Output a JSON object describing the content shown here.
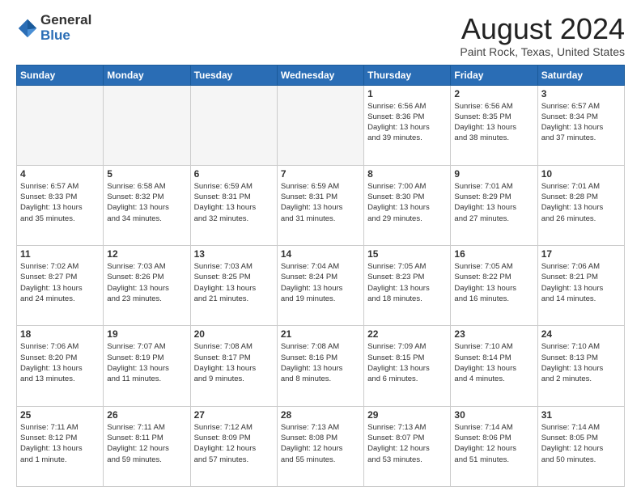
{
  "logo": {
    "general": "General",
    "blue": "Blue"
  },
  "header": {
    "month": "August 2024",
    "location": "Paint Rock, Texas, United States"
  },
  "weekdays": [
    "Sunday",
    "Monday",
    "Tuesday",
    "Wednesday",
    "Thursday",
    "Friday",
    "Saturday"
  ],
  "weeks": [
    [
      {
        "day": "",
        "info": ""
      },
      {
        "day": "",
        "info": ""
      },
      {
        "day": "",
        "info": ""
      },
      {
        "day": "",
        "info": ""
      },
      {
        "day": "1",
        "info": "Sunrise: 6:56 AM\nSunset: 8:36 PM\nDaylight: 13 hours\nand 39 minutes."
      },
      {
        "day": "2",
        "info": "Sunrise: 6:56 AM\nSunset: 8:35 PM\nDaylight: 13 hours\nand 38 minutes."
      },
      {
        "day": "3",
        "info": "Sunrise: 6:57 AM\nSunset: 8:34 PM\nDaylight: 13 hours\nand 37 minutes."
      }
    ],
    [
      {
        "day": "4",
        "info": "Sunrise: 6:57 AM\nSunset: 8:33 PM\nDaylight: 13 hours\nand 35 minutes."
      },
      {
        "day": "5",
        "info": "Sunrise: 6:58 AM\nSunset: 8:32 PM\nDaylight: 13 hours\nand 34 minutes."
      },
      {
        "day": "6",
        "info": "Sunrise: 6:59 AM\nSunset: 8:31 PM\nDaylight: 13 hours\nand 32 minutes."
      },
      {
        "day": "7",
        "info": "Sunrise: 6:59 AM\nSunset: 8:31 PM\nDaylight: 13 hours\nand 31 minutes."
      },
      {
        "day": "8",
        "info": "Sunrise: 7:00 AM\nSunset: 8:30 PM\nDaylight: 13 hours\nand 29 minutes."
      },
      {
        "day": "9",
        "info": "Sunrise: 7:01 AM\nSunset: 8:29 PM\nDaylight: 13 hours\nand 27 minutes."
      },
      {
        "day": "10",
        "info": "Sunrise: 7:01 AM\nSunset: 8:28 PM\nDaylight: 13 hours\nand 26 minutes."
      }
    ],
    [
      {
        "day": "11",
        "info": "Sunrise: 7:02 AM\nSunset: 8:27 PM\nDaylight: 13 hours\nand 24 minutes."
      },
      {
        "day": "12",
        "info": "Sunrise: 7:03 AM\nSunset: 8:26 PM\nDaylight: 13 hours\nand 23 minutes."
      },
      {
        "day": "13",
        "info": "Sunrise: 7:03 AM\nSunset: 8:25 PM\nDaylight: 13 hours\nand 21 minutes."
      },
      {
        "day": "14",
        "info": "Sunrise: 7:04 AM\nSunset: 8:24 PM\nDaylight: 13 hours\nand 19 minutes."
      },
      {
        "day": "15",
        "info": "Sunrise: 7:05 AM\nSunset: 8:23 PM\nDaylight: 13 hours\nand 18 minutes."
      },
      {
        "day": "16",
        "info": "Sunrise: 7:05 AM\nSunset: 8:22 PM\nDaylight: 13 hours\nand 16 minutes."
      },
      {
        "day": "17",
        "info": "Sunrise: 7:06 AM\nSunset: 8:21 PM\nDaylight: 13 hours\nand 14 minutes."
      }
    ],
    [
      {
        "day": "18",
        "info": "Sunrise: 7:06 AM\nSunset: 8:20 PM\nDaylight: 13 hours\nand 13 minutes."
      },
      {
        "day": "19",
        "info": "Sunrise: 7:07 AM\nSunset: 8:19 PM\nDaylight: 13 hours\nand 11 minutes."
      },
      {
        "day": "20",
        "info": "Sunrise: 7:08 AM\nSunset: 8:17 PM\nDaylight: 13 hours\nand 9 minutes."
      },
      {
        "day": "21",
        "info": "Sunrise: 7:08 AM\nSunset: 8:16 PM\nDaylight: 13 hours\nand 8 minutes."
      },
      {
        "day": "22",
        "info": "Sunrise: 7:09 AM\nSunset: 8:15 PM\nDaylight: 13 hours\nand 6 minutes."
      },
      {
        "day": "23",
        "info": "Sunrise: 7:10 AM\nSunset: 8:14 PM\nDaylight: 13 hours\nand 4 minutes."
      },
      {
        "day": "24",
        "info": "Sunrise: 7:10 AM\nSunset: 8:13 PM\nDaylight: 13 hours\nand 2 minutes."
      }
    ],
    [
      {
        "day": "25",
        "info": "Sunrise: 7:11 AM\nSunset: 8:12 PM\nDaylight: 13 hours\nand 1 minute."
      },
      {
        "day": "26",
        "info": "Sunrise: 7:11 AM\nSunset: 8:11 PM\nDaylight: 12 hours\nand 59 minutes."
      },
      {
        "day": "27",
        "info": "Sunrise: 7:12 AM\nSunset: 8:09 PM\nDaylight: 12 hours\nand 57 minutes."
      },
      {
        "day": "28",
        "info": "Sunrise: 7:13 AM\nSunset: 8:08 PM\nDaylight: 12 hours\nand 55 minutes."
      },
      {
        "day": "29",
        "info": "Sunrise: 7:13 AM\nSunset: 8:07 PM\nDaylight: 12 hours\nand 53 minutes."
      },
      {
        "day": "30",
        "info": "Sunrise: 7:14 AM\nSunset: 8:06 PM\nDaylight: 12 hours\nand 51 minutes."
      },
      {
        "day": "31",
        "info": "Sunrise: 7:14 AM\nSunset: 8:05 PM\nDaylight: 12 hours\nand 50 minutes."
      }
    ]
  ]
}
